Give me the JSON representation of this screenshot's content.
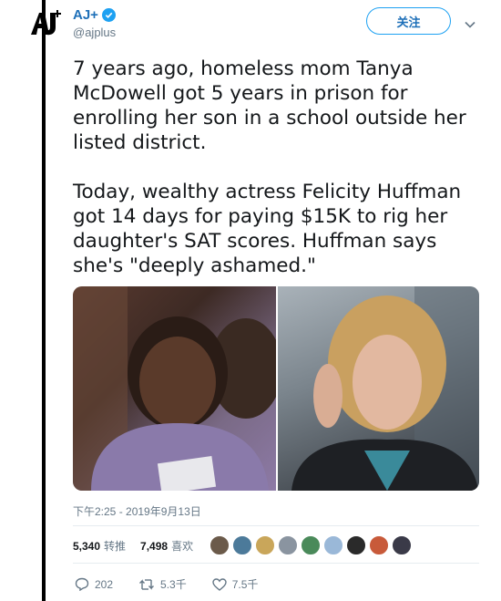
{
  "account": {
    "name": "AJ+",
    "handle": "@ajplus"
  },
  "follow_label": "关注",
  "tweet": {
    "paragraph1": "7 years ago, homeless mom Tanya McDowell got 5 years in prison for enrolling her son in a school outside her listed district.",
    "paragraph2": "Today, wealthy actress Felicity Huffman got 14 days for paying $15K to rig her daughter's SAT scores. Huffman says she's \"deeply ashamed.\""
  },
  "timestamp": "下午2:25 - 2019年9月13日",
  "stats": {
    "retweets_count": "5,340",
    "retweets_label": "转推",
    "likes_count": "7,498",
    "likes_label": "喜欢"
  },
  "avatar_colors": [
    "#6b5a4a",
    "#4c7a9a",
    "#c9a65a",
    "#8a94a0",
    "#4a8a5a",
    "#9ab8d8",
    "#2a2a2a",
    "#c85a3a",
    "#3a3a48"
  ],
  "actions": {
    "replies": "202",
    "retweets": "5.3千",
    "likes": "7.5千"
  },
  "colors": {
    "accent": "#1da1f2",
    "link": "#1d6fb8",
    "muted": "#657786"
  }
}
